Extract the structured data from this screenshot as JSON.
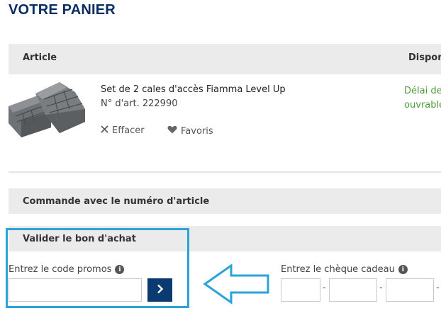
{
  "page_title": "VOTRE PANIER",
  "table": {
    "col_article": "Article",
    "col_dispo": "Dispon"
  },
  "item": {
    "name": "Set de 2 cales d'accès Fiamma Level Up",
    "article_number": "N° d'art. 222990",
    "remove_label": "Effacer",
    "favorite_label": "Favoris",
    "availability_line1": "Délai de",
    "availability_line2": "ouvrable"
  },
  "order_by_number": {
    "label": "Commande avec le numéro d'article"
  },
  "voucher": {
    "title": "Valider le bon d'achat",
    "promo_label": "Entrez le code promos",
    "promo_value": "",
    "gift_label": "Entrez le chèque cadeau",
    "separator": "-"
  },
  "colors": {
    "heading": "#0b2d63",
    "highlight_border": "#29a3d8",
    "availability": "#4f9a3a",
    "submit_button": "#0b3a70"
  },
  "icons": [
    "close-icon",
    "heart-icon",
    "info-icon",
    "chevron-right-icon",
    "arrow-left-icon"
  ]
}
